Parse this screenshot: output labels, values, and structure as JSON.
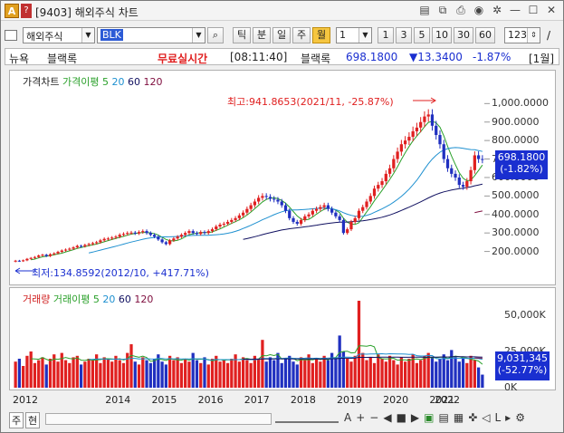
{
  "window": {
    "title": "[9403] 해외주식 차트",
    "icon_label": "A"
  },
  "toolbar": {
    "market_combo": "해외주식",
    "symbol_input": "BLK",
    "period_buttons": [
      "틱",
      "분",
      "일",
      "주",
      "월"
    ],
    "active_period": "월",
    "interval_value": "1",
    "quick_intervals": [
      "1",
      "3",
      "5",
      "10",
      "30",
      "60"
    ],
    "count_value": "123",
    "slash": "/"
  },
  "info": {
    "category": "뉴욕",
    "name": "블랙록",
    "realtime": "무료실시간",
    "time": "[08:11:40]",
    "name2": "블랙록",
    "price": "698.1800",
    "change": "▼13.3400",
    "change_pct": "-1.87%",
    "unit": "[1월]"
  },
  "price_panel": {
    "legend": [
      "가격차트",
      "가격이평 5",
      "20",
      "60",
      "120"
    ],
    "legend_colors": [
      "#222222",
      "#2aa02a",
      "#1e90d0",
      "#101060",
      "#801040"
    ],
    "high_label": "최고:941.8653(2021/11, -25.87%)",
    "low_label": "최저:134.8592(2012/10, +417.71%)",
    "current_price": "698.1800",
    "current_pct": "(-1.82%)",
    "y_ticks": [
      "1,000.0000",
      "900.0000",
      "800.0000",
      "700.0000",
      "600.0000",
      "500.0000",
      "400.0000",
      "300.0000",
      "200.0000"
    ]
  },
  "volume_panel": {
    "legend": [
      "거래량",
      "거래이평 5",
      "20",
      "60",
      "120"
    ],
    "legend_colors": [
      "#d02020",
      "#2aa02a",
      "#1e90d0",
      "#101060",
      "#801040"
    ],
    "current_volume": "9,031,345",
    "current_pct": "(-52.77%)",
    "y_ticks": [
      "50,000K",
      "25,000K",
      "0K"
    ]
  },
  "x_axis": [
    "2012",
    "2014",
    "2015",
    "2016",
    "2017",
    "2018",
    "2019",
    "2020",
    "2021",
    "2022"
  ],
  "bottom": {
    "tab_a": "주",
    "tab_b": "현"
  },
  "colors": {
    "up": "#e02020",
    "down": "#2030c0",
    "badge": "#1a2fd0"
  },
  "chart_data": {
    "type": "candlestick",
    "title": "",
    "x_start": "2012-01",
    "period": "month",
    "closes": [
      150,
      148,
      152,
      160,
      165,
      170,
      178,
      182,
      175,
      185,
      190,
      198,
      205,
      210,
      215,
      222,
      230,
      228,
      235,
      240,
      245,
      250,
      260,
      268,
      270,
      275,
      280,
      290,
      295,
      300,
      302,
      298,
      305,
      310,
      300,
      290,
      280,
      265,
      250,
      240,
      260,
      270,
      280,
      290,
      300,
      310,
      300,
      295,
      305,
      300,
      310,
      320,
      335,
      345,
      350,
      360,
      370,
      380,
      395,
      410,
      430,
      450,
      470,
      490,
      500,
      495,
      485,
      480,
      470,
      450,
      420,
      380,
      360,
      350,
      370,
      390,
      400,
      420,
      430,
      440,
      450,
      430,
      410,
      390,
      370,
      300,
      320,
      360,
      380,
      420,
      440,
      470,
      500,
      540,
      560,
      580,
      620,
      650,
      700,
      740,
      780,
      800,
      820,
      850,
      870,
      900,
      930,
      941,
      880,
      830,
      780,
      700,
      650,
      620,
      600,
      560,
      550,
      580,
      640,
      720,
      700,
      698
    ],
    "ylim": [
      100,
      1080
    ],
    "volumes_k": [
      18000,
      20000,
      15000,
      22000,
      25000,
      17000,
      19000,
      21000,
      16000,
      20000,
      23000,
      18000,
      24000,
      19000,
      17000,
      21000,
      22000,
      16000,
      18000,
      20000,
      19000,
      23000,
      17000,
      21000,
      20000,
      18000,
      22000,
      19000,
      17000,
      24000,
      30000,
      18000,
      16000,
      21000,
      19000,
      17000,
      20000,
      23000,
      18000,
      16000,
      22000,
      19000,
      21000,
      17000,
      20000,
      18000,
      24000,
      19000,
      17000,
      21000,
      16000,
      20000,
      22000,
      18000,
      19000,
      17000,
      20000,
      23000,
      18000,
      21000,
      19000,
      17000,
      22000,
      20000,
      33000,
      18000,
      21000,
      19000,
      24000,
      17000,
      20000,
      22000,
      18000,
      16000,
      21000,
      19000,
      23000,
      17000,
      20000,
      18000,
      22000,
      19000,
      24000,
      21000,
      36000,
      25000,
      20000,
      18000,
      22000,
      60000,
      24000,
      19000,
      21000,
      17000,
      23000,
      20000,
      18000,
      22000,
      19000,
      16000,
      21000,
      18000,
      20000,
      23000,
      17000,
      19000,
      22000,
      24000,
      21000,
      18000,
      20000,
      23000,
      19000,
      26000,
      21000,
      18000,
      20000,
      17000,
      22000,
      19000,
      14000,
      9031
    ],
    "vol_ylim": [
      0,
      60000
    ]
  }
}
